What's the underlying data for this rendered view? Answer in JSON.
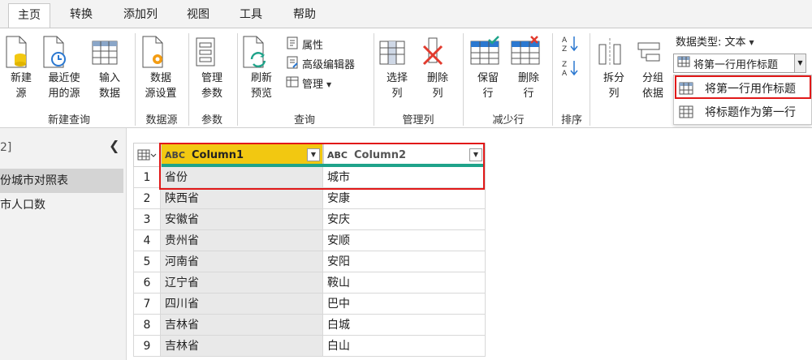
{
  "tabs": [
    "主页",
    "转换",
    "添加列",
    "视图",
    "工具",
    "帮助"
  ],
  "ribbon": {
    "new_source": "新建\n源",
    "recent_sources": "最近使\n用的源",
    "enter_data": "输入\n数据",
    "data_source_settings": "数据\n源设置",
    "manage_params": "管理\n参数",
    "refresh_preview": "刷新\n预览",
    "properties": "属性",
    "advanced_editor": "高级编辑器",
    "manage": "管理",
    "choose_columns": "选择\n列",
    "remove_columns": "删除\n列",
    "keep_rows": "保留\n行",
    "remove_rows": "删除\n行",
    "split_column": "拆分\n列",
    "group_by": "分组\n依据",
    "data_type": "数据类型: 文本",
    "use_first_row": "将第一行用作标题",
    "groups": {
      "new_query": "新建查询",
      "data_source": "数据源",
      "params": "参数",
      "query": "查询",
      "manage_columns": "管理列",
      "reduce_rows": "减少行",
      "sort": "排序"
    }
  },
  "dropdown": {
    "item1": "将第一行用作标题",
    "item2": "将标题作为第一行"
  },
  "leftpanel": {
    "header": "2]",
    "items": [
      "份城市对照表",
      "市人口数"
    ]
  },
  "table": {
    "columns": [
      "Column1",
      "Column2"
    ],
    "type_icon": "ABC",
    "rows": [
      {
        "n": "1",
        "c1": "省份",
        "c2": "城市"
      },
      {
        "n": "2",
        "c1": "陕西省",
        "c2": "安康"
      },
      {
        "n": "3",
        "c1": "安徽省",
        "c2": "安庆"
      },
      {
        "n": "4",
        "c1": "贵州省",
        "c2": "安顺"
      },
      {
        "n": "5",
        "c1": "河南省",
        "c2": "安阳"
      },
      {
        "n": "6",
        "c1": "辽宁省",
        "c2": "鞍山"
      },
      {
        "n": "7",
        "c1": "四川省",
        "c2": "巴中"
      },
      {
        "n": "8",
        "c1": "吉林省",
        "c2": "白城"
      },
      {
        "n": "9",
        "c1": "吉林省",
        "c2": "白山"
      }
    ]
  },
  "colors": {
    "header_yellow": "#f2c811",
    "accent_teal": "#1fa38a",
    "highlight_red": "#e11818"
  }
}
